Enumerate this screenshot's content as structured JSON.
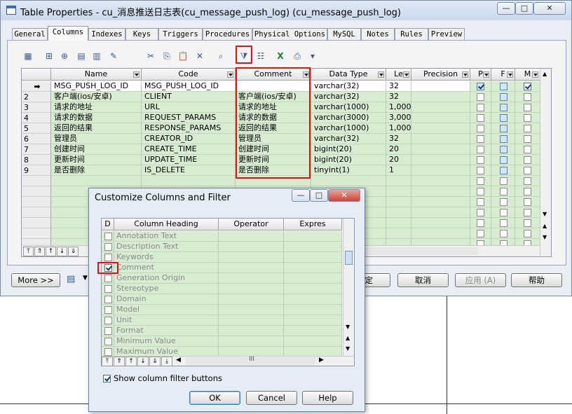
{
  "window": {
    "title": "Table Properties - cu_消息推送日志表(cu_message_push_log) (cu_message_push_log)",
    "minimize_glyph": "—",
    "maximize_glyph": "□",
    "close_glyph": "✕"
  },
  "tabs": [
    "General",
    "Columns",
    "Indexes",
    "Keys",
    "Triggers",
    "Procedures",
    "Physical Options",
    "MySQL",
    "Notes",
    "Rules",
    "Preview"
  ],
  "active_tab": "Columns",
  "toolbar_icons": [
    "properties-icon",
    "insert-row-icon",
    "add-row-icon",
    "add-columns-icon",
    "delete-columns-icon",
    "replace-icon",
    "find-icon",
    "cut-icon",
    "copy-icon",
    "paste-icon",
    "delete-icon",
    "find-binoculars-icon",
    "filter-icon",
    "customize-columns-icon",
    "excel-export-icon",
    "print-icon",
    "dropdown-icon"
  ],
  "grid": {
    "headers": [
      "Name",
      "Code",
      "Comment",
      "Data Type",
      "Le",
      "Precision",
      "P",
      "F",
      "M"
    ],
    "rows": [
      {
        "marker": "➡",
        "name": "MSG_PUSH_LOG_ID",
        "code": "MSG_PUSH_LOG_ID",
        "comment": "",
        "type": "varchar(32)",
        "len": "32",
        "precision": "",
        "p": true,
        "f": false,
        "m": true
      },
      {
        "marker": "2",
        "name": "客户端(ios/安卓)",
        "code": "CLIENT",
        "comment": "客户端(ios/安卓)",
        "type": "varchar(32)",
        "len": "32",
        "precision": "",
        "p": false,
        "f": false,
        "m": false
      },
      {
        "marker": "3",
        "name": "请求的地址",
        "code": "URL",
        "comment": "请求的地址",
        "type": "varchar(1000)",
        "len": "1,000",
        "precision": "",
        "p": false,
        "f": false,
        "m": false
      },
      {
        "marker": "4",
        "name": "请求的数据",
        "code": "REQUEST_PARAMS",
        "comment": "请求的数据",
        "type": "varchar(3000)",
        "len": "3,000",
        "precision": "",
        "p": false,
        "f": false,
        "m": false
      },
      {
        "marker": "5",
        "name": "返回的结果",
        "code": "RESPONSE_PARAMS",
        "comment": "返回的结果",
        "type": "varchar(1000)",
        "len": "1,000",
        "precision": "",
        "p": false,
        "f": false,
        "m": false
      },
      {
        "marker": "6",
        "name": "管理员",
        "code": "CREATOR_ID",
        "comment": "管理员",
        "type": "varchar(32)",
        "len": "32",
        "precision": "",
        "p": false,
        "f": false,
        "m": false
      },
      {
        "marker": "7",
        "name": "创建时间",
        "code": "CREATE_TIME",
        "comment": "创建时间",
        "type": "bigint(20)",
        "len": "20",
        "precision": "",
        "p": false,
        "f": false,
        "m": false
      },
      {
        "marker": "8",
        "name": "更新时间",
        "code": "UPDATE_TIME",
        "comment": "更新时间",
        "type": "bigint(20)",
        "len": "20",
        "precision": "",
        "p": false,
        "f": false,
        "m": false
      },
      {
        "marker": "9",
        "name": "是否删除",
        "code": "IS_DELETE",
        "comment": "是否删除",
        "type": "tinyint(1)",
        "len": "1",
        "precision": "",
        "p": false,
        "f": false,
        "m": false
      }
    ]
  },
  "bottom_buttons": {
    "more": "More >>",
    "ok_partial": "定",
    "cancel": "取消",
    "apply": "应用 (A)",
    "help": "帮助"
  },
  "dialog": {
    "title": "Customize Columns and Filter",
    "headers": [
      "D",
      "Column Heading",
      "Operator",
      "Expres"
    ],
    "rows": [
      {
        "label": "Annotation Text",
        "checked": false
      },
      {
        "label": "Description Text",
        "checked": false
      },
      {
        "label": "Keywords",
        "checked": false
      },
      {
        "label": "Comment",
        "checked": true
      },
      {
        "label": "Generation Origin",
        "checked": false
      },
      {
        "label": "Stereotype",
        "checked": false
      },
      {
        "label": "Domain",
        "checked": false
      },
      {
        "label": "Model",
        "checked": false
      },
      {
        "label": "Unit",
        "checked": false
      },
      {
        "label": "Format",
        "checked": false
      },
      {
        "label": "Minimum Value",
        "checked": false
      },
      {
        "label": "Maximum Value",
        "checked": false
      }
    ],
    "show_filter_label": "Show column filter buttons",
    "show_filter_checked": true,
    "ok": "OK",
    "cancel": "Cancel",
    "help": "Help",
    "hscroll_thumb": "III"
  }
}
